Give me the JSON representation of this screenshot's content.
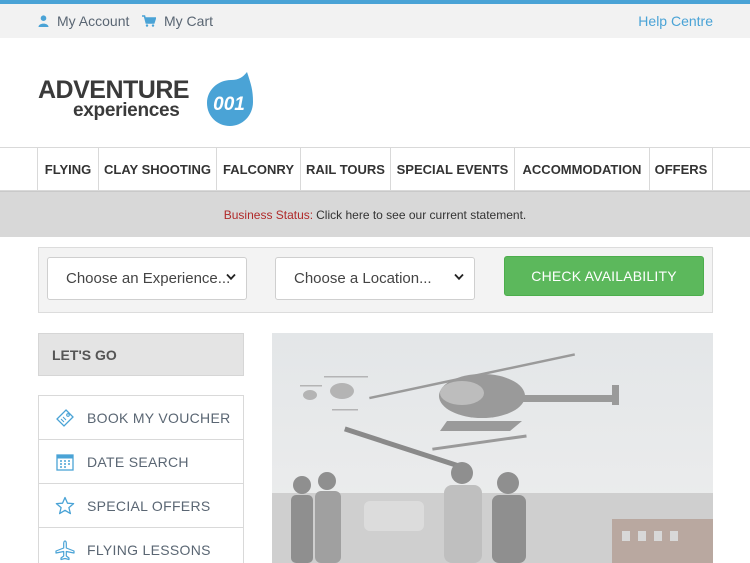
{
  "util_bar": {
    "account_label": "My Account",
    "cart_label": "My Cart",
    "help_label": "Help Centre"
  },
  "logo": {
    "line1": "ADVENTURE",
    "line2": "experiences",
    "badge": "001"
  },
  "nav": {
    "items": [
      {
        "label": "FLYING"
      },
      {
        "label": "CLAY SHOOTING"
      },
      {
        "label": "FALCONRY"
      },
      {
        "label": "RAIL TOURS"
      },
      {
        "label": "SPECIAL EVENTS"
      },
      {
        "label": "ACCOMMODATION"
      },
      {
        "label": "OFFERS"
      }
    ]
  },
  "status": {
    "label": "Business Status:",
    "message": "Click here to see our current statement."
  },
  "search": {
    "experience_select": "Choose an Experience...",
    "location_select": "Choose a Location...",
    "button_label": "CHECK AVAILABILITY"
  },
  "sidebar": {
    "heading": "LET'S GO",
    "items": [
      {
        "label": "BOOK MY VOUCHER",
        "icon": "voucher-icon"
      },
      {
        "label": "DATE SEARCH",
        "icon": "calendar-icon"
      },
      {
        "label": "SPECIAL OFFERS",
        "icon": "star-icon"
      },
      {
        "label": "FLYING LESSONS",
        "icon": "plane-icon"
      }
    ]
  },
  "colors": {
    "accent": "#4aa3d6",
    "button_green": "#5cb85c",
    "status_red": "#b02a2a"
  }
}
